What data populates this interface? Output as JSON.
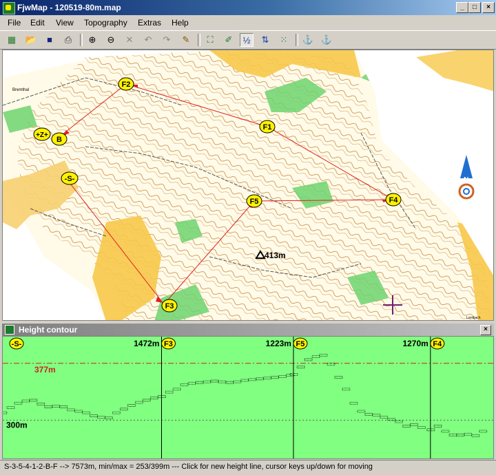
{
  "window": {
    "title": "FjwMap - 120519-80m.map",
    "controls": [
      "_",
      "□",
      "×"
    ]
  },
  "menu": [
    "File",
    "Edit",
    "View",
    "Topography",
    "Extras",
    "Help"
  ],
  "toolbar": {
    "buttons": [
      {
        "name": "new-map-icon",
        "glyph": "▦",
        "color": "#2a7a2a"
      },
      {
        "name": "open-folder-icon",
        "glyph": "📂",
        "color": "#b08000"
      },
      {
        "name": "save-disk-icon",
        "glyph": "■",
        "color": "#1a237e"
      },
      {
        "name": "print-icon",
        "glyph": "⎙",
        "color": "#333333"
      },
      {
        "name": "zoom-in-icon",
        "glyph": "⊕",
        "color": "#000000"
      },
      {
        "name": "zoom-out-icon",
        "glyph": "⊖",
        "color": "#000000"
      },
      {
        "name": "delete-icon",
        "glyph": "✕",
        "color": "#888888"
      },
      {
        "name": "undo-icon",
        "glyph": "↶",
        "color": "#888888"
      },
      {
        "name": "redo-icon",
        "glyph": "↷",
        "color": "#888888"
      },
      {
        "name": "ruler-pencil-icon",
        "glyph": "✎",
        "color": "#8a5a00"
      },
      {
        "name": "course-select-icon",
        "glyph": "⛶",
        "color": "#2a7a2a"
      },
      {
        "name": "draw-pencil-icon",
        "glyph": "✐",
        "color": "#2a7a2a"
      },
      {
        "name": "numbering-icon",
        "glyph": "½",
        "color": "#1a3aa0"
      },
      {
        "name": "sort-order-icon",
        "glyph": "⇅",
        "color": "#1a3aa0"
      },
      {
        "name": "dots-grid-icon",
        "glyph": "⁙",
        "color": "#2a7a2a"
      },
      {
        "name": "anchor-start-icon",
        "glyph": "⚓",
        "color": "#2a7a2a"
      },
      {
        "name": "anchor-end-icon",
        "glyph": "⚓",
        "color": "#2a7a2a"
      }
    ]
  },
  "map": {
    "labels": {
      "town_west": "Bremthal",
      "town_southeast": "Lorsbach"
    },
    "controls": [
      {
        "id": "F2",
        "label": "F2"
      },
      {
        "id": "F1",
        "label": "F1"
      },
      {
        "id": "Z",
        "label": "+Z+"
      },
      {
        "id": "B",
        "label": "B"
      },
      {
        "id": "S",
        "label": "-S-"
      },
      {
        "id": "F5",
        "label": "F5"
      },
      {
        "id": "F4",
        "label": "F4"
      },
      {
        "id": "F3",
        "label": "F3"
      }
    ],
    "summit_label": "413m"
  },
  "height_pane": {
    "title": "Height contour",
    "close": "×"
  },
  "chart_data": {
    "type": "line",
    "title": "",
    "xlabel": "",
    "ylabel": "",
    "reference_lines": [
      {
        "value": 377,
        "label": "377m",
        "style": "dash-dot",
        "color": "#d02020"
      },
      {
        "value": 300,
        "label": "300m",
        "style": "dotted",
        "color": "#606060"
      }
    ],
    "leg_markers": [
      {
        "control": "-S-",
        "distance_label": ""
      },
      {
        "control": "F3",
        "distance_label": "1472m"
      },
      {
        "control": "F5",
        "distance_label": "1223m"
      },
      {
        "control": "F4",
        "distance_label": "1270m"
      }
    ],
    "ylim": [
      253,
      399
    ],
    "series": [
      {
        "x": [
          0,
          70,
          140,
          210,
          280,
          350,
          420,
          490,
          560,
          630,
          700,
          770,
          840,
          910,
          980,
          1050,
          1120,
          1190,
          1260,
          1330,
          1400,
          1472,
          1540,
          1610,
          1680,
          1750,
          1820,
          1890,
          1960,
          2030,
          2100,
          2170,
          2240,
          2310,
          2380,
          2450,
          2520,
          2590,
          2660,
          2695,
          2760,
          2830,
          2900,
          2970,
          3040,
          3110,
          3180,
          3250,
          3320,
          3390,
          3460,
          3530,
          3600,
          3670,
          3740,
          3810,
          3880,
          3965,
          4030,
          4100,
          4170,
          4240,
          4310,
          4380,
          4450
        ],
        "values": [
          310,
          317,
          323,
          326,
          327,
          322,
          318,
          319,
          318,
          314,
          312,
          310,
          306,
          304,
          303,
          310,
          315,
          320,
          324,
          327,
          330,
          332,
          338,
          342,
          348,
          350,
          351,
          352,
          353,
          352,
          351,
          352,
          354,
          355,
          356,
          357,
          358,
          359,
          361,
          362,
          372,
          382,
          386,
          388,
          376,
          358,
          342,
          323,
          312,
          308,
          307,
          304,
          301,
          298,
          292,
          294,
          290,
          287,
          292,
          285,
          280,
          280,
          281,
          279,
          285
        ]
      }
    ]
  },
  "status": {
    "text": "S-3-5-4-1-2-B-F --> 7573m, min/max = 253/399m  ---  Click for new height line, cursor keys up/down for moving"
  }
}
